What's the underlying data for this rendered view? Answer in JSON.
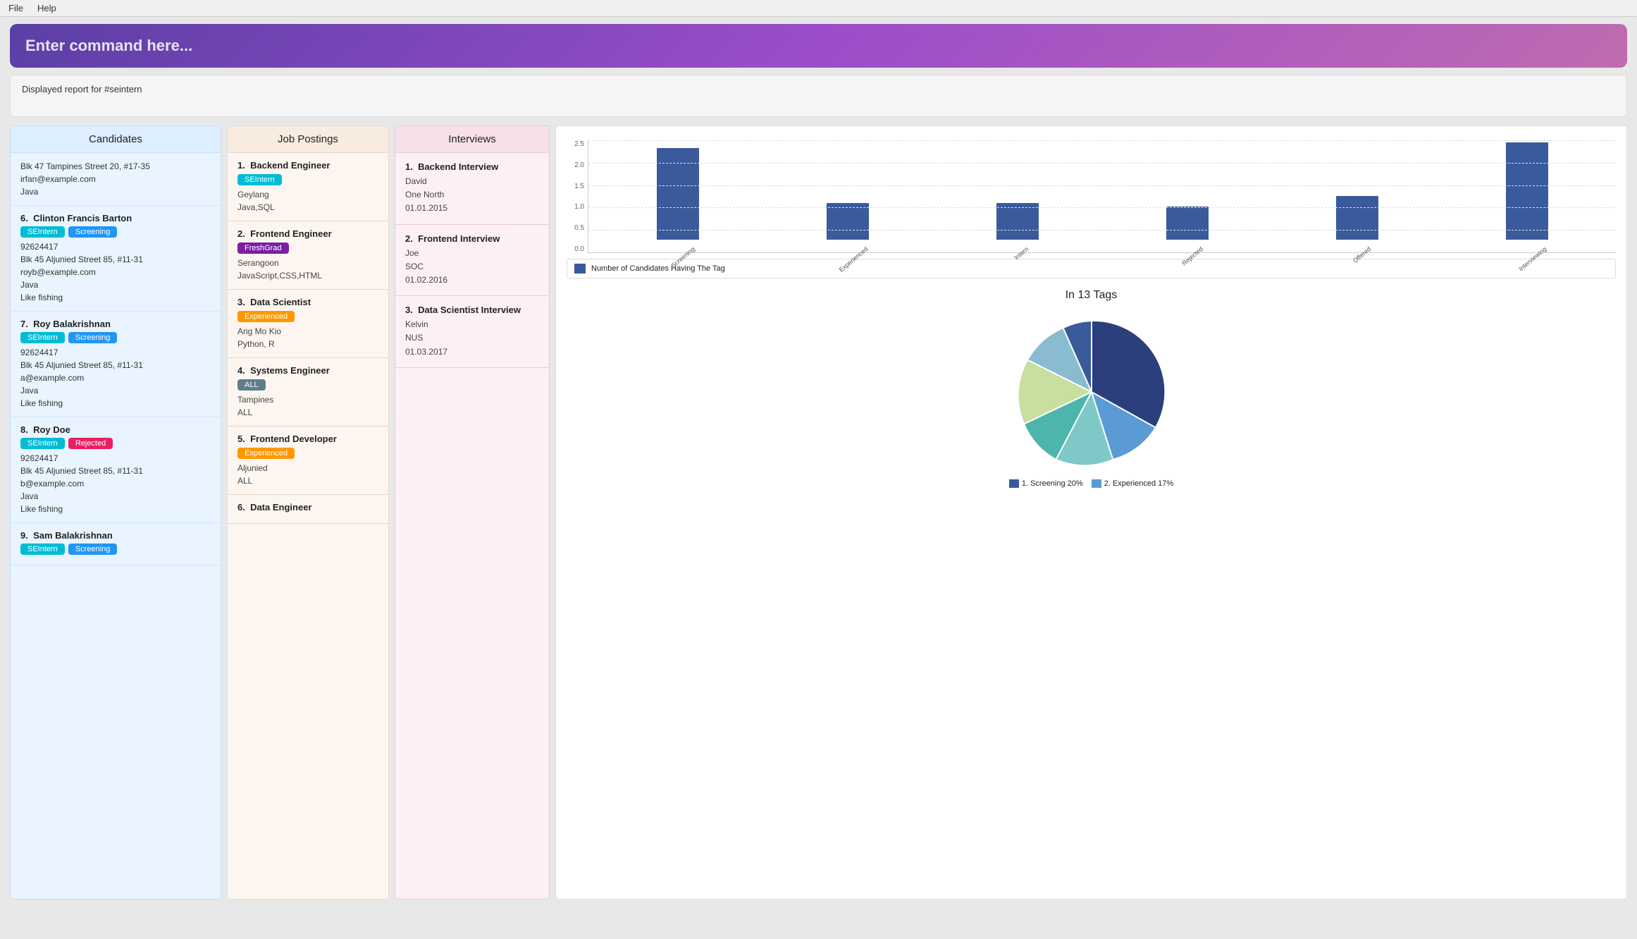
{
  "menubar": {
    "file_label": "File",
    "help_label": "Help"
  },
  "command_bar": {
    "placeholder": "Enter command here..."
  },
  "status": {
    "text": "Displayed report for #seintern"
  },
  "candidates": {
    "header": "Candidates",
    "items": [
      {
        "number": "",
        "name": "Blk 47 Tampines Street 20, #17-35",
        "details": [
          "irfan@example.com",
          "Java"
        ],
        "tags": []
      },
      {
        "number": "6.",
        "name": "Clinton Francis Barton",
        "tags": [
          "SEIntern",
          "Screening"
        ],
        "details": [
          "92624417",
          "Blk 45 Aljunied Street 85, #11-31",
          "royb@example.com",
          "Java",
          "Like fishing"
        ]
      },
      {
        "number": "7.",
        "name": "Roy Balakrishnan",
        "tags": [
          "SEIntern",
          "Screening"
        ],
        "details": [
          "92624417",
          "Blk 45 Aljunied Street 85, #11-31",
          "a@example.com",
          "Java",
          "Like fishing"
        ]
      },
      {
        "number": "8.",
        "name": "Roy Doe",
        "tags": [
          "SEIntern",
          "Rejected"
        ],
        "details": [
          "92624417",
          "Blk 45 Aljunied Street 85, #11-31",
          "b@example.com",
          "Java",
          "Like fishing"
        ]
      },
      {
        "number": "9.",
        "name": "Sam Balakrishnan",
        "tags": [
          "SEIntern",
          "Screening"
        ],
        "details": []
      }
    ]
  },
  "jobs": {
    "header": "Job Postings",
    "items": [
      {
        "number": "1.",
        "title": "Backend Engineer",
        "tags": [
          "SEIntern"
        ],
        "details": [
          "Geylang",
          "Java,SQL"
        ]
      },
      {
        "number": "2.",
        "title": "Frontend Engineer",
        "tags": [
          "FreshGrad"
        ],
        "details": [
          "Serangoon",
          "JavaScript,CSS,HTML"
        ]
      },
      {
        "number": "3.",
        "title": "Data Scientist",
        "tags": [
          "Experienced"
        ],
        "details": [
          "Ang Mo Kio",
          "Python, R"
        ]
      },
      {
        "number": "4.",
        "title": "Systems Engineer",
        "tags": [
          "ALL"
        ],
        "details": [
          "Tampines",
          "ALL"
        ]
      },
      {
        "number": "5.",
        "title": "Frontend Developer",
        "tags": [
          "Experienced"
        ],
        "details": [
          "Aljunied",
          "ALL"
        ]
      },
      {
        "number": "6.",
        "title": "Data Engineer",
        "tags": [],
        "details": []
      }
    ]
  },
  "interviews": {
    "header": "Interviews",
    "items": [
      {
        "number": "1.",
        "title": "Backend Interview",
        "details": [
          "David",
          "One North",
          "01.01.2015"
        ]
      },
      {
        "number": "2.",
        "title": "Frontend Interview",
        "details": [
          "Joe",
          "SOC",
          "01.02.2016"
        ]
      },
      {
        "number": "3.",
        "title": "Data Scientist Interview",
        "details": [
          "Kelvin",
          "NUS",
          "01.03.2017"
        ]
      }
    ]
  },
  "bar_chart": {
    "title": "Number of Candidates Having The Tag",
    "y_labels": [
      "2.5",
      "2.0",
      "1.5",
      "1.0",
      "0.5",
      "0.0"
    ],
    "bars": [
      {
        "label": "Screening",
        "height_pct": 90,
        "value": 2.5
      },
      {
        "label": "Experienced",
        "height_pct": 35,
        "value": 1.0
      },
      {
        "label": "Intern",
        "height_pct": 35,
        "value": 1.0
      },
      {
        "label": "Rejected",
        "height_pct": 30,
        "value": 0.9
      },
      {
        "label": "Offered",
        "height_pct": 42,
        "value": 1.2
      },
      {
        "label": "Interviewing",
        "height_pct": 95,
        "value": 2.6
      }
    ]
  },
  "pie_chart": {
    "title": "In 13 Tags",
    "legend_items": [
      {
        "label": "Screening 20%",
        "color": "#3a5a9c"
      },
      {
        "label": "Experienced 17%",
        "color": "#5b9bd5"
      }
    ]
  },
  "tag_styles": {
    "SEIntern": "seintern",
    "Screening": "screening",
    "Rejected": "rejected",
    "FreshGrad": "freshgrad",
    "Experienced": "experienced",
    "ALL": "all",
    "Intern": "intern",
    "Offered": "offered",
    "Interviewing": "interviewing"
  }
}
